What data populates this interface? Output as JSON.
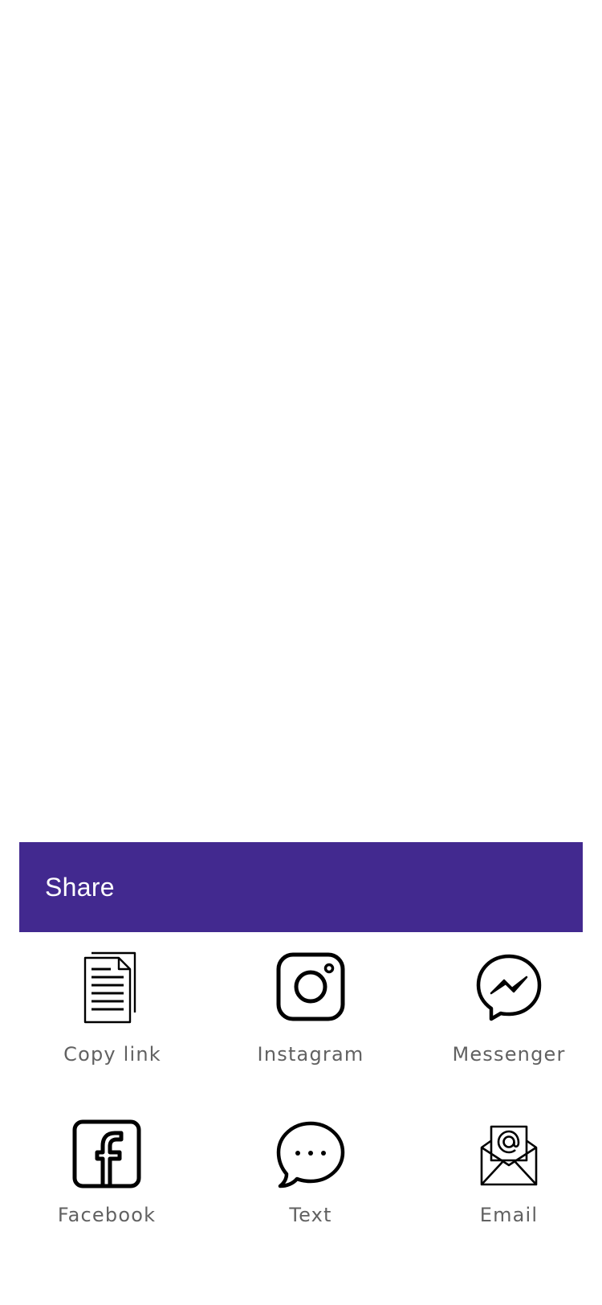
{
  "share_sheet": {
    "title": "Share",
    "header_color": "#42298f",
    "options": [
      {
        "label": "Copy link",
        "icon": "document-copy-icon"
      },
      {
        "label": "Instagram",
        "icon": "instagram-icon"
      },
      {
        "label": "Messenger",
        "icon": "messenger-icon"
      },
      {
        "label": "Facebook",
        "icon": "facebook-icon"
      },
      {
        "label": "Text",
        "icon": "chat-bubble-icon"
      },
      {
        "label": "Email",
        "icon": "envelope-at-icon"
      }
    ]
  }
}
